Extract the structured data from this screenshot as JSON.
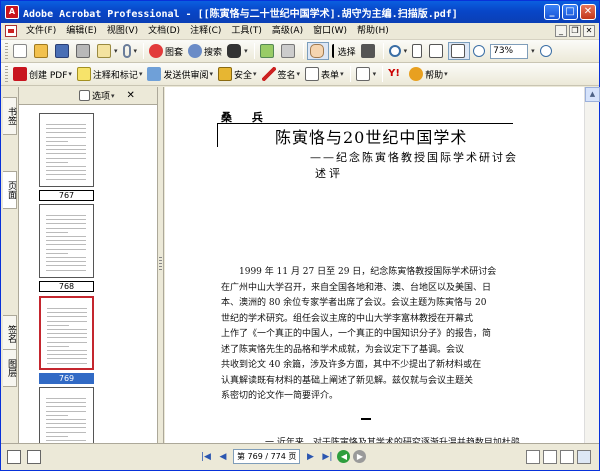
{
  "window": {
    "title": "Adobe Acrobat Professional - [[陈寅恪与二十世纪中国学术].胡守为主编.扫描版.pdf]",
    "controls": [
      "_",
      "□",
      "✕"
    ]
  },
  "menu": {
    "items": [
      "文件(F)",
      "编辑(E)",
      "视图(V)",
      "文档(D)",
      "注释(C)",
      "工具(T)",
      "高级(A)",
      "窗口(W)",
      "帮助(H)"
    ]
  },
  "toolbar1": {
    "organizer_label": "图套",
    "search_label": "搜索",
    "select_label": "选择",
    "zoom_value": "73%"
  },
  "toolbar2": {
    "create_pdf": "创建 PDF",
    "comment": "注释和标记",
    "review": "发送供审阅",
    "secure": "安全",
    "sign": "签名",
    "forms": "表单",
    "help": "帮助"
  },
  "sidebar": {
    "tabs": [
      "书签",
      "页面",
      "签名",
      "图层"
    ],
    "options_label": "选项",
    "close": "✕",
    "thumbnails": [
      {
        "label": "767",
        "selected": false
      },
      {
        "label": "768",
        "selected": false
      },
      {
        "label": "769",
        "selected": true
      },
      {
        "label": "",
        "selected": false
      }
    ]
  },
  "document": {
    "author": "桑 兵",
    "title": "陈寅恪与20世纪中国学术",
    "subtitle": "——纪念陈寅恪教授国际学术研讨会",
    "subtitle2": "述评",
    "paragraph": [
      "1999 年 11 月 27 日至 29 日，纪念陈寅恪教授国际学术研讨会",
      "在广州中山大学召开，来自全国各地和港、澳、台地区以及美国、日",
      "本、澳洲的 80 余位专家学者出席了会议。会议主题为陈寅恪与 20",
      "世纪的学术研究。组任会议主席的中山大学李富林教授在开幕式",
      "上作了《一个真正的中国人，一个真正的中国知识分子》的报告，简",
      "述了陈寅恪先生的品格和学术成就，为会议定下了基调。会议",
      "共收到论文 40 余篇，涉及许多方面，其中不少提出了新材料或在",
      "认真解读既有材料的基础上阐述了新见解。兹仅就与会议主题关",
      "系密切的论文作一简要评介。"
    ],
    "cut_line": "一 近年来，对于陈寅恪及其学术的研究逐渐升温并趋数目加杜鹃"
  },
  "statusbar": {
    "page_display": "第 769 / 774 页"
  }
}
